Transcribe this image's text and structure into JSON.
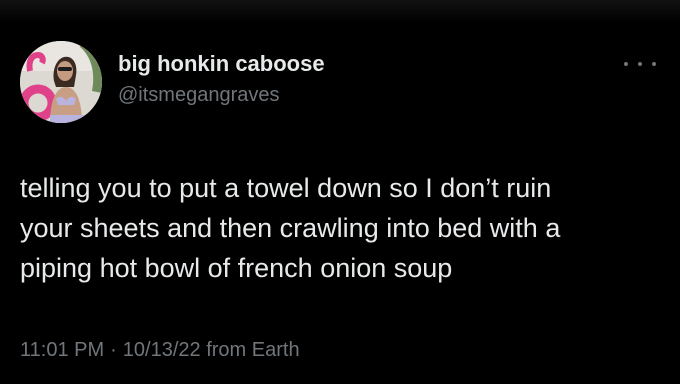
{
  "tweet": {
    "display_name": "big honkin caboose",
    "handle": "@itsmegangraves",
    "more_icon": "more-horizontal-icon",
    "text_lines": [
      "telling you to put a towel down so I don’t ruin",
      "your sheets and then crawling into bed with a",
      "piping hot bowl of french onion soup"
    ],
    "time": "11:01 PM",
    "separator": "·",
    "date": "10/13/22",
    "source": "from Earth"
  },
  "colors": {
    "background": "#000000",
    "primary_text": "#e7e9ea",
    "secondary_text": "#71767b"
  }
}
